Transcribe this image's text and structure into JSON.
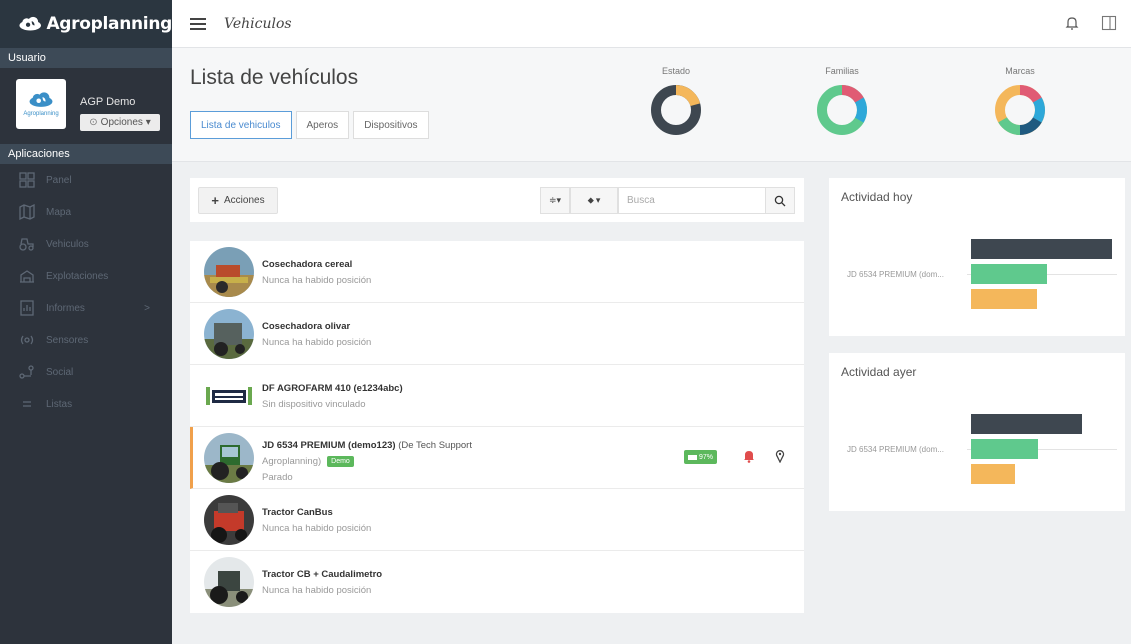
{
  "app": {
    "name": "Agroplanning"
  },
  "topbar": {
    "title": "Vehiculos"
  },
  "sidebar": {
    "user_section": "Usuario",
    "user_name": "AGP Demo",
    "avatar_caption": "Agroplanning",
    "options_label": "Opciones ▾",
    "apps_section": "Aplicaciones",
    "items": [
      {
        "label": "Panel",
        "icon": "panel-icon"
      },
      {
        "label": "Mapa",
        "icon": "map-icon"
      },
      {
        "label": "Vehiculos",
        "icon": "vehicles-icon"
      },
      {
        "label": "Explotaciones",
        "icon": "farms-icon"
      },
      {
        "label": "Informes",
        "icon": "reports-icon",
        "arrow": ">"
      },
      {
        "label": "Sensores",
        "icon": "sensors-icon"
      },
      {
        "label": "Social",
        "icon": "social-icon"
      },
      {
        "label": "Listas",
        "icon": "lists-icon"
      }
    ]
  },
  "header": {
    "title": "Lista de vehículos",
    "tabs": [
      {
        "label": "Lista de vehiculos"
      },
      {
        "label": "Aperos"
      },
      {
        "label": "Dispositivos"
      }
    ],
    "donuts": [
      {
        "label": "Estado"
      },
      {
        "label": "Familias"
      },
      {
        "label": "Marcas"
      }
    ]
  },
  "toolbar": {
    "actions_label": "Acciones",
    "sort_label": "≑▾",
    "tag_label": "▾",
    "search_placeholder": "Busca"
  },
  "vehicles": [
    {
      "name": "Cosechadora cereal",
      "status": "Nunca ha habido posición"
    },
    {
      "name": "Cosechadora olivar",
      "status": "Nunca ha habido posición"
    },
    {
      "name": "DF AGROFARM 410 (e1234abc)",
      "status": "Sin dispositivo vinculado"
    },
    {
      "name": "JD 6534 PREMIUM (demo123)",
      "owner": "(De Tech Support",
      "owner2": "Agroplanning)",
      "badge": "Demo",
      "status": "Parado",
      "battery": "97%"
    },
    {
      "name": "Tractor CanBus",
      "status": "Nunca ha habido posición"
    },
    {
      "name": "Tractor CB + Caudalimetro",
      "status": "Nunca ha habido posición"
    }
  ],
  "activity": [
    {
      "title": "Actividad hoy",
      "label": "JD 6534 PREMIUM (dom..."
    },
    {
      "title": "Actividad ayer",
      "label": "JD 6534 PREMIUM (dom..."
    }
  ],
  "colors": {
    "dark": "#3e4750",
    "green": "#5fc98d",
    "orange": "#f4b75b",
    "pink": "#e05b74",
    "blue": "#2ea8d9",
    "navy": "#1f5a80"
  }
}
